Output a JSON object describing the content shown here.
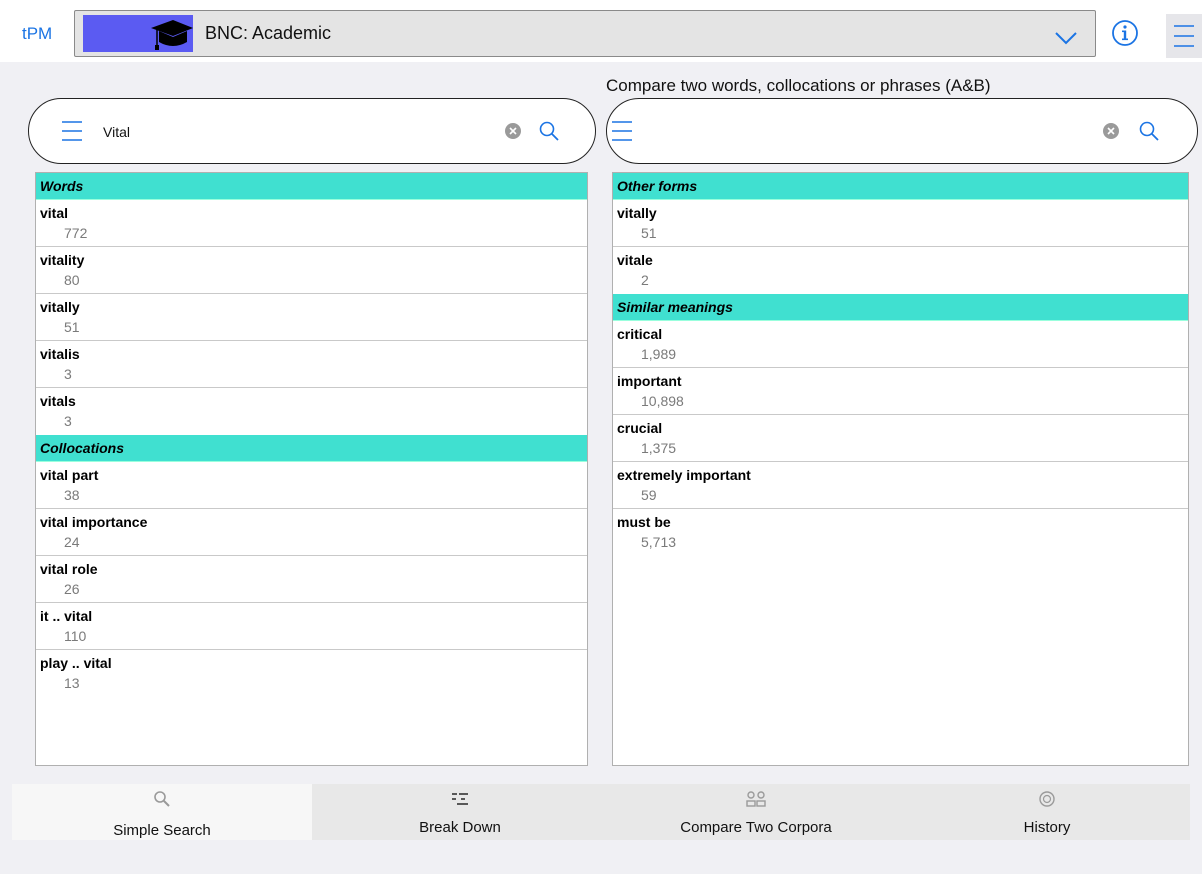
{
  "header": {
    "app_label": "tPM",
    "corpus_name": "BNC: Academic"
  },
  "compare_heading": "Compare two words, collocations or phrases (A&B)",
  "search_a": {
    "value": "Vital",
    "placeholder": ""
  },
  "search_b": {
    "value": "",
    "placeholder": ""
  },
  "list_a": {
    "sections": [
      {
        "title": "Words",
        "items": [
          {
            "term": "vital",
            "count": "772"
          },
          {
            "term": "vitality",
            "count": "80"
          },
          {
            "term": "vitally",
            "count": "51"
          },
          {
            "term": "vitalis",
            "count": "3"
          },
          {
            "term": "vitals",
            "count": "3"
          }
        ]
      },
      {
        "title": "Collocations",
        "items": [
          {
            "term": "vital part",
            "count": "38"
          },
          {
            "term": "vital importance",
            "count": "24"
          },
          {
            "term": "vital role",
            "count": "26"
          },
          {
            "term": "it .. vital",
            "count": "110"
          },
          {
            "term": "play .. vital",
            "count": "13"
          }
        ]
      }
    ]
  },
  "list_b": {
    "sections": [
      {
        "title": "Other forms",
        "items": [
          {
            "term": "vitally",
            "count": "51"
          },
          {
            "term": "vitale",
            "count": "2"
          }
        ]
      },
      {
        "title": "Similar meanings",
        "items": [
          {
            "term": "critical",
            "count": "1,989"
          },
          {
            "term": "important",
            "count": "10,898"
          },
          {
            "term": "crucial",
            "count": "1,375"
          },
          {
            "term": "extremely important",
            "count": "59"
          },
          {
            "term": "must be",
            "count": "5,713"
          }
        ]
      }
    ]
  },
  "tabs": [
    {
      "label": "Simple Search",
      "icon": "search-icon",
      "active": true
    },
    {
      "label": "Break Down",
      "icon": "break-down-icon",
      "active": false
    },
    {
      "label": "Compare Two Corpora",
      "icon": "compare-icon",
      "active": false
    },
    {
      "label": "History",
      "icon": "history-icon",
      "active": false
    }
  ],
  "colors": {
    "accent": "#1b74e4",
    "section_header": "#40e0d0",
    "corpus_swatch": "#5b5bf2"
  }
}
